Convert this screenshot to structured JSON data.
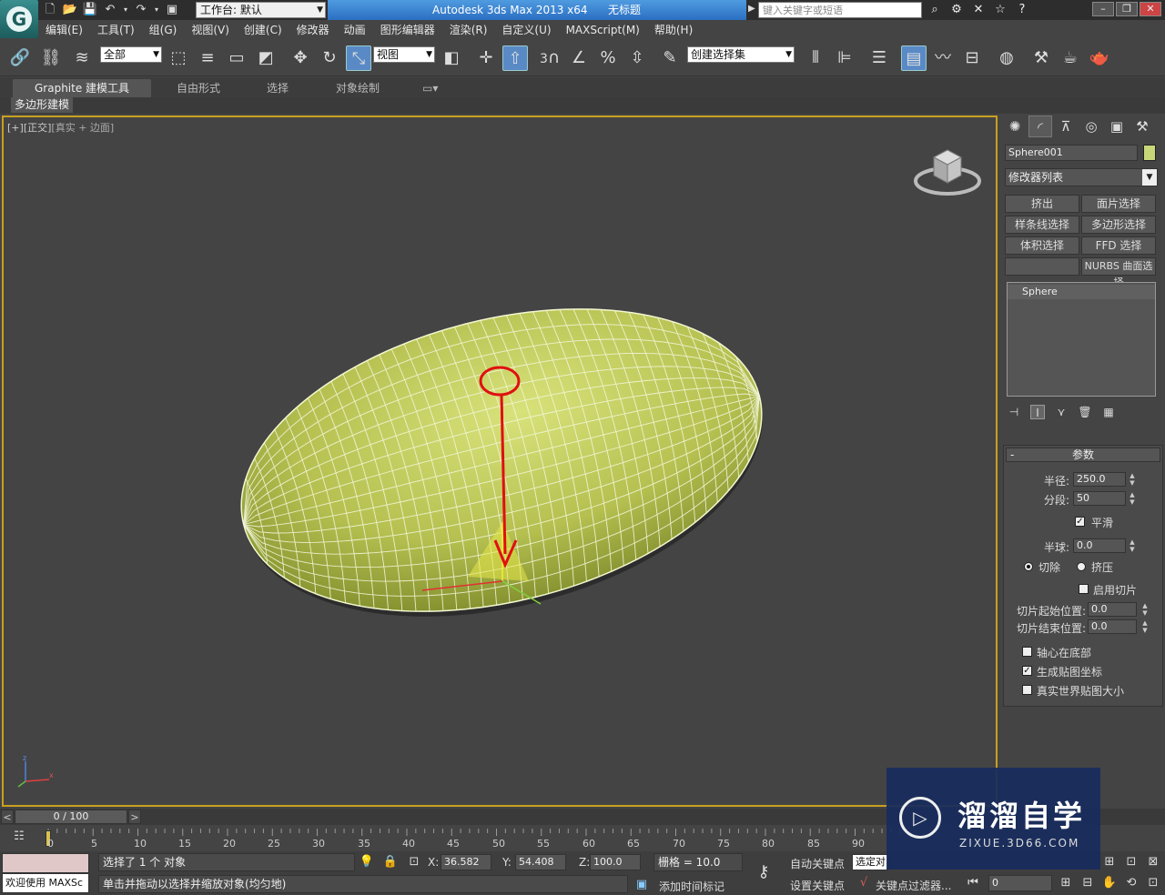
{
  "titlebar": {
    "app_name": "Autodesk 3ds Max  2013 x64",
    "doc_name": "无标题",
    "workspace": "工作台: 默认",
    "search_placeholder": "键入关键字或短语"
  },
  "menu": [
    "编辑(E)",
    "工具(T)",
    "组(G)",
    "视图(V)",
    "创建(C)",
    "修改器",
    "动画",
    "图形编辑器",
    "渲染(R)",
    "自定义(U)",
    "MAXScript(M)",
    "帮助(H)"
  ],
  "toolbar": {
    "selection_filter": "全部",
    "ref_coord": "视图",
    "named_selection": "创建选择集",
    "snap_3": "3",
    "snap_pct": "%"
  },
  "ribbon": {
    "tabs": [
      "Graphite 建模工具",
      "自由形式",
      "选择",
      "对象绘制"
    ],
    "subtab": "多边形建模"
  },
  "viewport": {
    "label_plus": "[+]",
    "label_view": "[正交]",
    "label_shading": "[真实 + 边面]"
  },
  "command_panel": {
    "object_name": "Sphere001",
    "object_color": "#c8d878",
    "modifier_list": "修改器列表",
    "modifier_buttons": [
      "挤出",
      "面片选择",
      "样条线选择",
      "多边形选择",
      "体积选择",
      "FFD 选择",
      "",
      "NURBS 曲面选择"
    ],
    "stack_item": "Sphere",
    "rollout_title": "参数",
    "radius_label": "半径:",
    "radius_value": "250.0",
    "segments_label": "分段:",
    "segments_value": "50",
    "smooth_label": "平滑",
    "smooth_checked": true,
    "hemisphere_label": "半球:",
    "hemisphere_value": "0.0",
    "chop_label": "切除",
    "squash_label": "挤压",
    "slice_on_label": "启用切片",
    "slice_from_label": "切片起始位置:",
    "slice_from_value": "0.0",
    "slice_to_label": "切片结束位置:",
    "slice_to_value": "0.0",
    "base_to_pivot_label": "轴心在底部",
    "gen_map_label": "生成贴图坐标",
    "real_world_label": "真实世界贴图大小"
  },
  "timeline": {
    "frame_display": "0 / 100",
    "ticks": [
      "0",
      "5",
      "10",
      "15",
      "20",
      "25",
      "30",
      "35",
      "40",
      "45",
      "50",
      "55",
      "60",
      "65",
      "70",
      "75",
      "80",
      "85",
      "90"
    ]
  },
  "status": {
    "welcome": "欢迎使用 MAXSc",
    "selected": "选择了 1 个 对象",
    "prompt": "单击并拖动以选择并缩放对象(均匀地)",
    "x_label": "X:",
    "x_value": "36.582",
    "y_label": "Y:",
    "y_value": "54.408",
    "z_label": "Z:",
    "z_value": "100.0",
    "grid": "栅格 = 10.0",
    "add_time_tag": "添加时间标记",
    "auto_key": "自动关键点",
    "set_key": "设置关键点",
    "selected_dd": "选定对",
    "key_filters": "关键点过滤器...",
    "frame_value": "0"
  },
  "watermark": {
    "title": "溜溜自学",
    "subtitle": "ZIXUE.3D66.COM"
  }
}
